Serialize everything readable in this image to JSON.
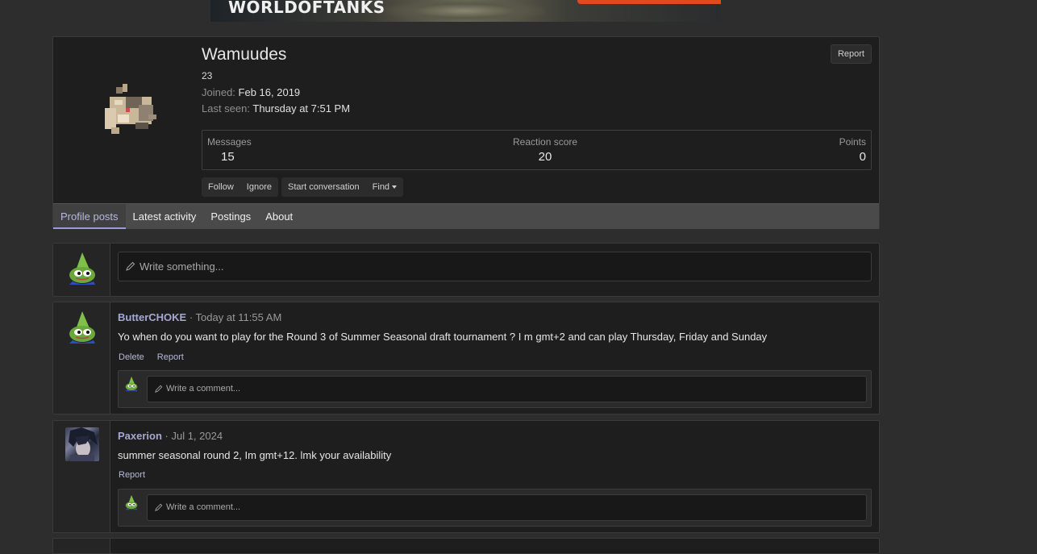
{
  "banner": {
    "brand_text": "WORLDOFTANKS"
  },
  "profile": {
    "username": "Wamuudes",
    "age": "23",
    "joined_label": "Joined:",
    "joined_value": "Feb 16, 2019",
    "last_seen_label": "Last seen:",
    "last_seen_value": "Thursday at 7:51 PM",
    "report_label": "Report",
    "stats": {
      "messages_label": "Messages",
      "messages_value": "15",
      "reaction_label": "Reaction score",
      "reaction_value": "20",
      "points_label": "Points",
      "points_value": "0"
    },
    "buttons": {
      "follow": "Follow",
      "ignore": "Ignore",
      "start_conversation": "Start conversation",
      "find": "Find"
    }
  },
  "tabs": [
    {
      "label": "Profile posts",
      "active": true
    },
    {
      "label": "Latest activity",
      "active": false
    },
    {
      "label": "Postings",
      "active": false
    },
    {
      "label": "About",
      "active": false
    }
  ],
  "composer": {
    "placeholder": "Write something..."
  },
  "posts": [
    {
      "author": "ButterCHOKE",
      "time": " · Today at 11:55 AM",
      "body": "Yo when do you want to play for the Round 3 of Summer Seasonal draft tournament ? I m gmt+2 and can play Thursday, Friday and Sunday",
      "actions": [
        "Delete",
        "Report"
      ],
      "comment_placeholder": "Write a comment..."
    },
    {
      "author": "Paxerion",
      "time": " · Jul 1, 2024",
      "body": "summer seasonal round 2, Im gmt+12. lmk your availability",
      "actions": [
        "Report"
      ],
      "comment_placeholder": "Write a comment..."
    }
  ],
  "colors": {
    "page_bg": "#2d2d2d",
    "card_bg": "#1e1e1e",
    "tab_bar": "#4a4a4a",
    "accent": "#9b9bd8",
    "link": "#a7a7d4"
  }
}
